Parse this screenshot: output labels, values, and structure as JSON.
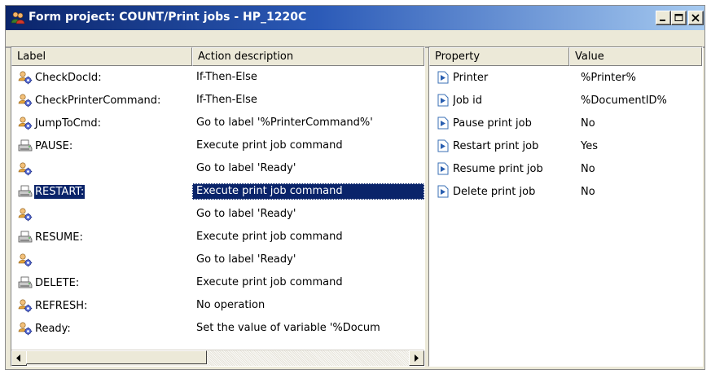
{
  "window": {
    "title": "Form project: COUNT/Print jobs - HP_1220C",
    "accent": "#0a246a"
  },
  "left_table": {
    "columns": [
      "Label",
      "Action description"
    ],
    "rows": [
      {
        "icon": "gear-user-icon",
        "label": "CheckDocId:",
        "action": "If-Then-Else"
      },
      {
        "icon": "gear-user-icon",
        "label": "CheckPrinterCommand:",
        "action": "If-Then-Else"
      },
      {
        "icon": "gear-user-icon",
        "label": "JumpToCmd:",
        "action": "Go to label '%PrinterCommand%'"
      },
      {
        "icon": "printer-icon",
        "label": "PAUSE:",
        "action": "Execute print job command"
      },
      {
        "icon": "gear-user-icon",
        "label": "",
        "action": "Go to label 'Ready'"
      },
      {
        "icon": "printer-icon",
        "label": "RESTART:",
        "action": "Execute print job command",
        "selected": true
      },
      {
        "icon": "gear-user-icon",
        "label": "",
        "action": "Go to label 'Ready'"
      },
      {
        "icon": "printer-icon",
        "label": "RESUME:",
        "action": "Execute print job command"
      },
      {
        "icon": "gear-user-icon",
        "label": "",
        "action": "Go to label 'Ready'"
      },
      {
        "icon": "printer-icon",
        "label": "DELETE:",
        "action": "Execute print job command"
      },
      {
        "icon": "gear-user-icon",
        "label": "REFRESH:",
        "action": "No operation"
      },
      {
        "icon": "gear-user-icon",
        "label": "Ready:",
        "action": "Set the value of variable '%Docum"
      }
    ]
  },
  "right_table": {
    "columns": [
      "Property",
      "Value"
    ],
    "rows": [
      {
        "icon": "property-arrow-icon",
        "property": "Printer",
        "value": "%Printer%"
      },
      {
        "icon": "property-arrow-icon",
        "property": "Job id",
        "value": "%DocumentID%"
      },
      {
        "icon": "property-arrow-icon",
        "property": "Pause print job",
        "value": "No"
      },
      {
        "icon": "property-arrow-icon",
        "property": "Restart print job",
        "value": "Yes"
      },
      {
        "icon": "property-arrow-icon",
        "property": "Resume print job",
        "value": "No"
      },
      {
        "icon": "property-arrow-icon",
        "property": "Delete print job",
        "value": "No"
      }
    ]
  }
}
